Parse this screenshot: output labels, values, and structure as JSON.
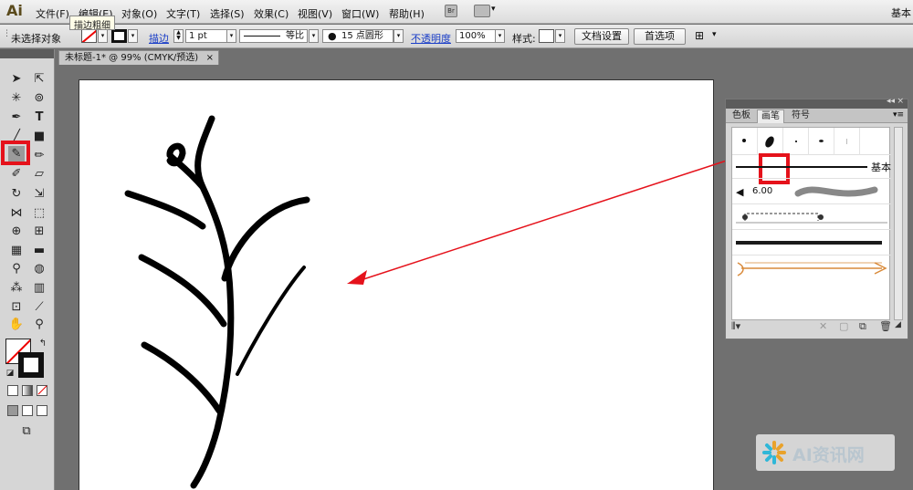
{
  "app": {
    "logo": "Ai",
    "workspace": "基本"
  },
  "menu": [
    "文件(F)",
    "编辑(E)",
    "对象(O)",
    "文字(T)",
    "选择(S)",
    "效果(C)",
    "视图(V)",
    "窗口(W)",
    "帮助(H)"
  ],
  "menu_icons": {
    "bridge": "Br"
  },
  "tooltip": "描边粗细",
  "control": {
    "selection_status": "未选择对象",
    "stroke_label": "描边",
    "stroke_weight": "1 pt",
    "profile": "等比",
    "brush_def": "15 点圆形",
    "opacity_label": "不透明度",
    "opacity_value": "100%",
    "style_label": "样式:",
    "doc_setup": "文档设置",
    "preferences": "首选项"
  },
  "document_tab": {
    "title": "未标题-1* @ 99% (CMYK/预选)",
    "close": "×"
  },
  "brushes_panel": {
    "tabs": [
      "色板",
      "画笔",
      "符号"
    ],
    "active_tab": "画笔",
    "basic_label": "基本",
    "art_brush_value": "6.00"
  },
  "watermark": {
    "text": "AI资讯网"
  },
  "colors": {
    "highlight": "#e5121b",
    "arrow": "#e5121b",
    "link": "#1a3ec8"
  }
}
